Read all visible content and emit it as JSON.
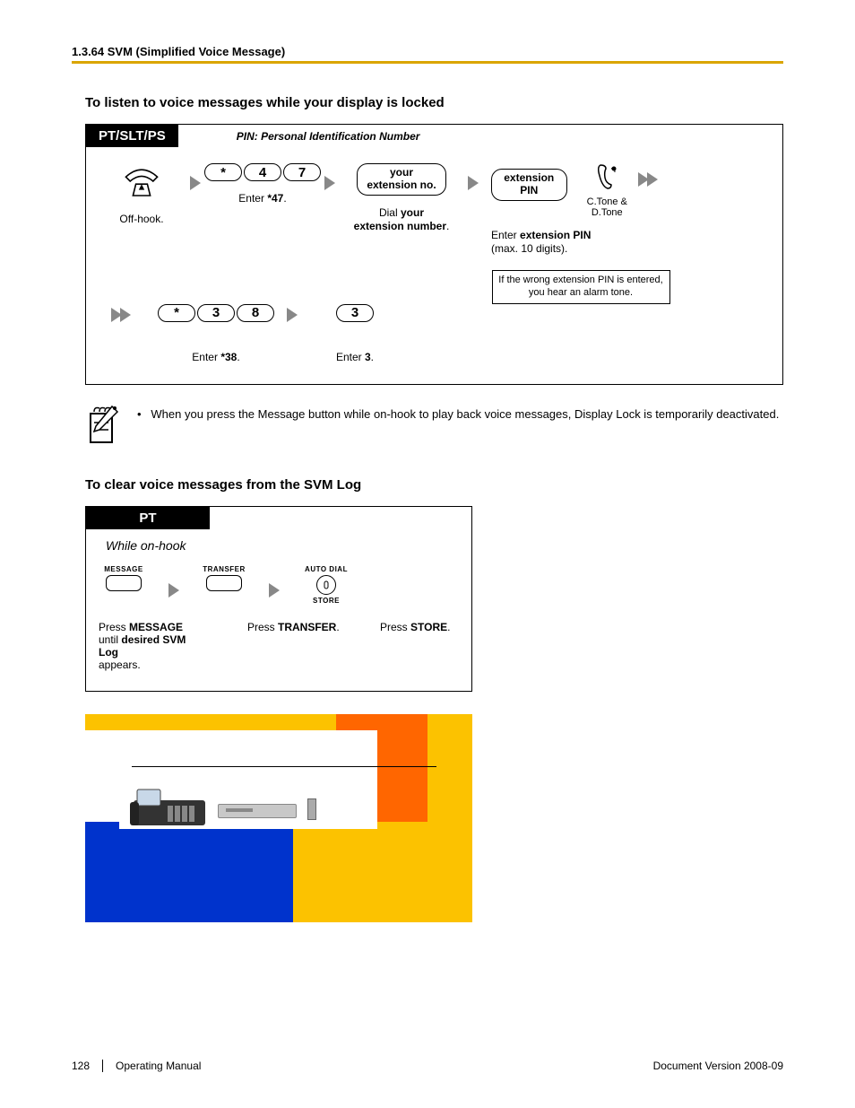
{
  "header": "1.3.64 SVM (Simplified Voice Message)",
  "section1_title": "To listen to voice messages while your display is locked",
  "diag1": {
    "title": "PT/SLT/PS",
    "pin_note": "PIN: Personal Identification Number",
    "step1": "Off-hook.",
    "step2_keys": [
      "*",
      "4",
      "7"
    ],
    "step2_caption_prefix": "Enter ",
    "step2_caption_bold": "*47",
    "step2_caption_suffix": ".",
    "step3_pill_line1": "your",
    "step3_pill_line2": "extension no.",
    "step3_caption_prefix": "Dial ",
    "step3_caption_bold1": "your",
    "step3_caption_mid": " ",
    "step3_caption_bold2": "extension number",
    "step3_caption_suffix": ".",
    "step4_pill": "extension PIN",
    "step4_tone": "C.Tone & D.Tone",
    "step4_caption_prefix": "Enter ",
    "step4_caption_bold": "extension PIN",
    "step4_caption_line2": "(max. 10 digits).",
    "alarm_note": "If the wrong extension PIN is entered, you hear an alarm tone.",
    "row2_keys": [
      "*",
      "3",
      "8"
    ],
    "row2_caption_prefix": "Enter ",
    "row2_caption_bold": "*38",
    "row2_caption_suffix": ".",
    "row2b_key": "3",
    "row2b_caption_prefix": "Enter ",
    "row2b_caption_bold": "3",
    "row2b_caption_suffix": "."
  },
  "note_text": "When you press the Message button while on-hook to play back voice messages, Display Lock is temporarily deactivated.",
  "note_bullet": "•",
  "section2_title": "To clear voice messages from the SVM Log",
  "diag2": {
    "title": "PT",
    "on_hook": "While on-hook",
    "btn1_top": "MESSAGE",
    "btn1_caption_prefix": "Press ",
    "btn1_caption_bold1": "MESSAGE",
    "btn1_caption_mid": " until ",
    "btn1_caption_bold2": "desired SVM Log",
    "btn1_caption_suffix": " appears.",
    "btn2_top": "TRANSFER",
    "btn2_caption_prefix": "Press ",
    "btn2_caption_bold": "TRANSFER",
    "btn2_caption_suffix": ".",
    "btn3_top1": "AUTO DIAL",
    "btn3_top2": "STORE",
    "btn3_caption_prefix": "Press ",
    "btn3_caption_bold": "STORE",
    "btn3_caption_suffix": "."
  },
  "footer": {
    "page": "128",
    "manual": "Operating Manual",
    "version": "Document Version  2008-09"
  }
}
